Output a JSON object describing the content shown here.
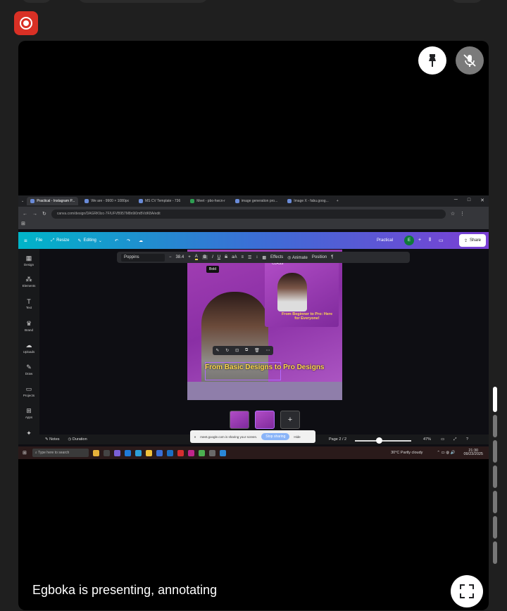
{
  "meet": {
    "presenting_label": "Egboka is presenting, annotating"
  },
  "browser": {
    "tabs": [
      {
        "label": "Practical - Instagram P..."
      },
      {
        "label": "We are - 9900 × 1080px"
      },
      {
        "label": "MS CV Template - 736"
      },
      {
        "label": "Meet - pbo-hwcn-r"
      },
      {
        "label": "image generation pro..."
      },
      {
        "label": "Image X - fabu.goog..."
      }
    ],
    "address": "canva.com/design/DAGRK9zc-7F/UFVB957M8n9i0mBVdK8A/edit"
  },
  "canva": {
    "menu": {
      "file": "File",
      "resize": "Resize",
      "editing": "Editing"
    },
    "doc_title": "Practical",
    "avatar_initial": "E",
    "share": "Share",
    "sidebar": [
      {
        "label": "Design"
      },
      {
        "label": "Elements"
      },
      {
        "label": "Text"
      },
      {
        "label": "Brand"
      },
      {
        "label": "Uploads"
      },
      {
        "label": "Draw"
      },
      {
        "label": "Projects"
      },
      {
        "label": "Apps"
      }
    ],
    "toolbar": {
      "font": "Poppins",
      "font_size": "38.4",
      "effects": "Effects",
      "animate": "Animate",
      "position": "Position",
      "bold_tooltip": "Bold"
    },
    "design": {
      "title": "From Basic Designs to Pro Designs",
      "inset_text": "From Beginner to Pro: Here for Everyone!",
      "inset_logo": "CLASS"
    },
    "bottom": {
      "notes": "Notes",
      "duration": "Duration",
      "sharing": "meet.google.com is sharing your screen.",
      "stop_sharing": "Stop sharing",
      "hide": "Hide",
      "page": "Page 2 / 2",
      "zoom": "47%"
    }
  },
  "taskbar": {
    "search_placeholder": "Type here to search",
    "weather": "30°C  Partly cloudy",
    "time": "21:30",
    "date": "09/23/2025"
  }
}
